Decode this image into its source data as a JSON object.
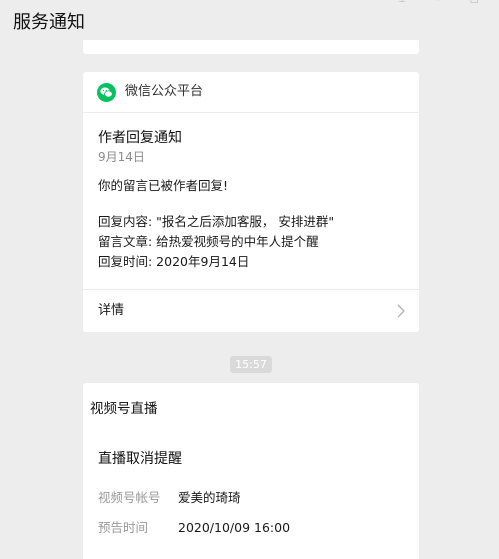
{
  "header": {
    "title": "服务通知"
  },
  "official_card": {
    "source_name": "微信公众平台",
    "title": "作者回复通知",
    "date": "9月14日",
    "lines": [
      "你的留言已被作者回复!",
      "回复内容: \"报名之后添加客服， 安排进群\"",
      "留言文章: 给热爱视频号的中年人提个醒",
      "回复时间: 2020年9月14日"
    ],
    "detail_label": "详情"
  },
  "timestamp": "15:57",
  "live_card": {
    "source_name": "视频号直播",
    "title": "直播取消提醒",
    "fields": [
      {
        "key": "视频号帐号",
        "value": "爱美的琦琦"
      },
      {
        "key": "预告时间",
        "value": "2020/10/09 16:00"
      }
    ]
  },
  "colors": {
    "background": "#ededed",
    "card": "#ffffff",
    "wechat_green": "#07c160",
    "secondary_text": "#8d8d8d"
  },
  "icons": {
    "source": "wechat-icon",
    "detail": "chevron-right-icon"
  }
}
